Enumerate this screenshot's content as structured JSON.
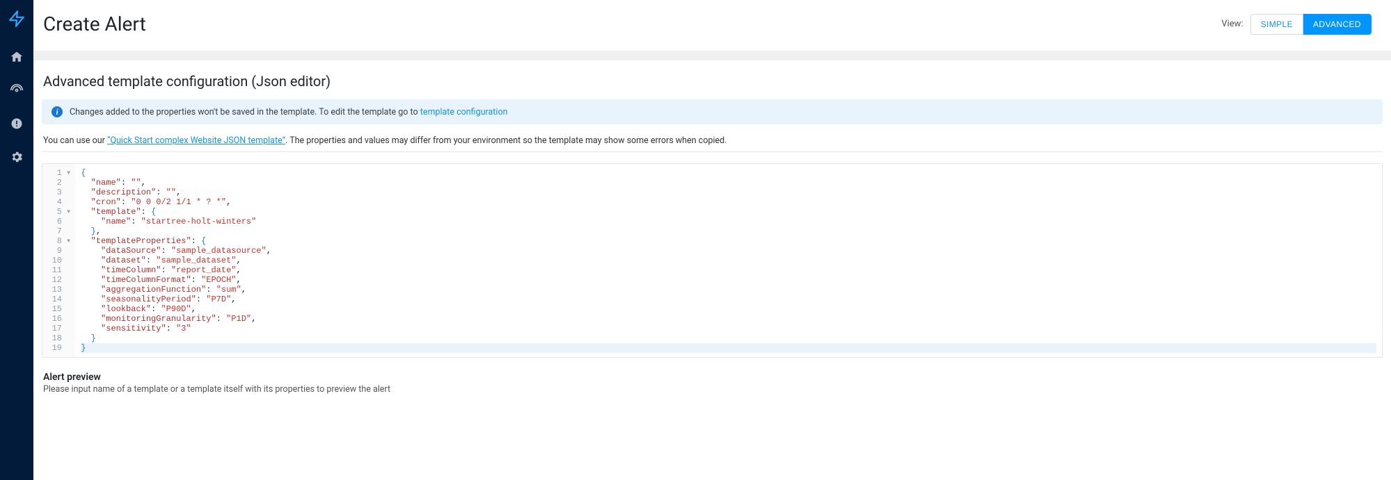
{
  "header": {
    "title": "Create Alert",
    "view_label": "View:",
    "toggle_simple": "SIMPLE",
    "toggle_advanced": "ADVANCED"
  },
  "sidebar": {
    "items": [
      {
        "name": "home",
        "label": "Home"
      },
      {
        "name": "radar",
        "label": "Detection"
      },
      {
        "name": "alerts",
        "label": "Alerts"
      },
      {
        "name": "settings",
        "label": "Settings"
      }
    ]
  },
  "section": {
    "title": "Advanced template configuration (Json editor)"
  },
  "banner": {
    "text": "Changes added to the properties won't be saved in the template. To edit the template go to",
    "link_text": "template configuration"
  },
  "helper": {
    "pre": "You can use our ",
    "link": "Quick Start complex Website JSON template",
    "post": ". The properties and values may differ from your environment so the template may show some errors when copied."
  },
  "editor": {
    "gutter_lines": [
      "1",
      "2",
      "3",
      "4",
      "5",
      "6",
      "7",
      "8",
      "9",
      "10",
      "11",
      "12",
      "13",
      "14",
      "15",
      "16",
      "17",
      "18",
      "19"
    ],
    "fold_marks": [
      "▾",
      " ",
      " ",
      " ",
      "▾",
      " ",
      " ",
      "▾",
      " ",
      " ",
      " ",
      " ",
      " ",
      " ",
      " ",
      " ",
      " ",
      " ",
      " "
    ],
    "json_config": {
      "name": "",
      "description": "",
      "cron": "0 0 0/2 1/1 * ? *",
      "template": {
        "name": "startree-holt-winters"
      },
      "templateProperties": {
        "dataSource": "sample_datasource",
        "dataset": "sample_dataset",
        "timeColumn": "report_date",
        "timeColumnFormat": "EPOCH",
        "aggregationFunction": "sum",
        "seasonalityPeriod": "P7D",
        "lookback": "P90D",
        "monitoringGranularity": "P1D",
        "sensitivity": "3"
      }
    },
    "lines": [
      {
        "indent": 0,
        "kind": "open"
      },
      {
        "indent": 1,
        "kind": "kv",
        "k": "name",
        "v": "",
        "comma": true
      },
      {
        "indent": 1,
        "kind": "kv",
        "k": "description",
        "v": "",
        "comma": true
      },
      {
        "indent": 1,
        "kind": "kv",
        "k": "cron",
        "v": "0 0 0/2 1/1 * ? *",
        "comma": true
      },
      {
        "indent": 1,
        "kind": "obj-open",
        "k": "template"
      },
      {
        "indent": 2,
        "kind": "kv",
        "k": "name",
        "v": "startree-holt-winters",
        "comma": false
      },
      {
        "indent": 1,
        "kind": "obj-close",
        "comma": true
      },
      {
        "indent": 1,
        "kind": "obj-open",
        "k": "templateProperties"
      },
      {
        "indent": 2,
        "kind": "kv",
        "k": "dataSource",
        "v": "sample_datasource",
        "comma": true
      },
      {
        "indent": 2,
        "kind": "kv",
        "k": "dataset",
        "v": "sample_dataset",
        "comma": true
      },
      {
        "indent": 2,
        "kind": "kv",
        "k": "timeColumn",
        "v": "report_date",
        "comma": true
      },
      {
        "indent": 2,
        "kind": "kv",
        "k": "timeColumnFormat",
        "v": "EPOCH",
        "comma": true
      },
      {
        "indent": 2,
        "kind": "kv",
        "k": "aggregationFunction",
        "v": "sum",
        "comma": true
      },
      {
        "indent": 2,
        "kind": "kv",
        "k": "seasonalityPeriod",
        "v": "P7D",
        "comma": true
      },
      {
        "indent": 2,
        "kind": "kv",
        "k": "lookback",
        "v": "P90D",
        "comma": true
      },
      {
        "indent": 2,
        "kind": "kv",
        "k": "monitoringGranularity",
        "v": "P1D",
        "comma": true
      },
      {
        "indent": 2,
        "kind": "kv",
        "k": "sensitivity",
        "v": "3",
        "comma": false
      },
      {
        "indent": 1,
        "kind": "obj-close",
        "comma": false
      },
      {
        "indent": 0,
        "kind": "close",
        "hl": true
      }
    ]
  },
  "preview": {
    "title": "Alert preview",
    "subtitle": "Please input name of a template or a template itself with its properties to preview the alert"
  }
}
